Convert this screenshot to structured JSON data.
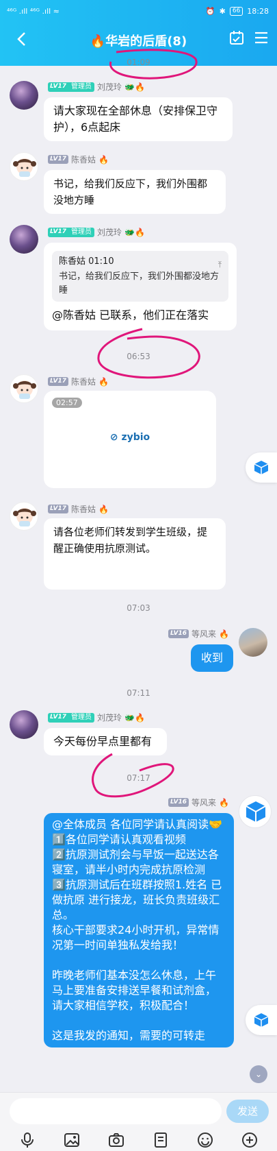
{
  "status_bar": {
    "left": "⁴⁶ᴳ .ıll ⁴⁶ᴳ .ıll ≈",
    "battery": "66",
    "time": "18:28"
  },
  "header": {
    "title": "🔥华岩的后盾(8)",
    "back_icon": "back-chevron-icon",
    "calendar_icon": "calendar-check-icon",
    "menu_icon": "menu-icon"
  },
  "timestamps": [
    "01:09",
    "06:53",
    "07:03",
    "07:11",
    "07:17"
  ],
  "messages": [
    {
      "level": "LV17",
      "role": "管理员",
      "sender": "刘茂玲",
      "text": "请大家现在全部休息（安排保卫守护），6点起床"
    },
    {
      "level": "LV17",
      "sender": "陈香姑",
      "text": "书记，给我们反应下，我们外围都没地方睡"
    },
    {
      "level": "LV17",
      "role": "管理员",
      "sender": "刘茂玲",
      "quote": {
        "header": "陈香姑 01:10",
        "text": "书记，给我们反应下，我们外围都没地方睡"
      },
      "text": "@陈香姑 已联系，他们正在落实"
    },
    {
      "level": "LV17",
      "sender": "陈香姑",
      "video_duration": "02:57",
      "video_logo": "zybio"
    },
    {
      "level": "LV17",
      "sender": "陈香姑",
      "text": "请各位老师们转发到学生班级，提醒正确使用抗原测试。"
    },
    {
      "level": "LV16",
      "sender": "等风来",
      "text": "收到"
    },
    {
      "level": "LV17",
      "role": "管理员",
      "sender": "刘茂玲",
      "text": "今天每份早点里都有"
    },
    {
      "level": "LV16",
      "sender": "等风来",
      "lines": [
        "@全体成员 各位同学请认真阅读🤝",
        "1️⃣各位同学请认真观看视频",
        "2️⃣抗原测试剂会与早饭一起送达各寝室，请半小时内完成抗原检测",
        "3️⃣抗原测试后在班群按照1.姓名 已做抗原 进行接龙，班长负责班级汇总。",
        "核心干部要求24小时开机，异常情况第一时间单独私发给我！",
        "",
        "昨晚老师们基本没怎么休息，上午马上要准备安排送早餐和试剂盒，请大家相信学校，积极配合！",
        "",
        "这是我发的通知，需要的可转走"
      ]
    }
  ],
  "input": {
    "placeholder": "",
    "send_label": "发送"
  },
  "toolbar_icons": [
    "mic-icon",
    "image-icon",
    "camera-icon",
    "file-icon",
    "emoji-icon",
    "plus-icon"
  ],
  "colors": {
    "header": "#1aa8f0",
    "bubble_self": "#1e96ef",
    "annotation": "#e0167a"
  }
}
